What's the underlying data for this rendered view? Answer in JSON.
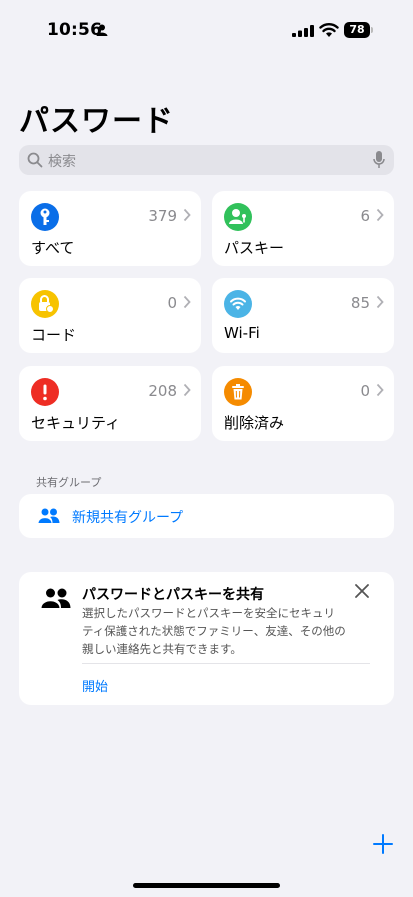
{
  "status_bar": {
    "time": "10:56",
    "battery": "78"
  },
  "page": {
    "title": "パスワード"
  },
  "search": {
    "placeholder": "検索"
  },
  "tiles": [
    {
      "label": "すべて",
      "count": "379",
      "color": "#0a6ee8",
      "icon": "key-icon"
    },
    {
      "label": "パスキー",
      "count": "6",
      "color": "#31c15b",
      "icon": "passkey-person-icon"
    },
    {
      "label": "コード",
      "count": "0",
      "color": "#f7c300",
      "icon": "lock-clock-icon"
    },
    {
      "label": "Wi-Fi",
      "count": "85",
      "color": "#4bb4e6",
      "icon": "wifi-icon"
    },
    {
      "label": "セキュリティ",
      "count": "208",
      "color": "#ee2d24",
      "icon": "exclamation-icon"
    },
    {
      "label": "削除済み",
      "count": "0",
      "color": "#f58b00",
      "icon": "trash-icon"
    }
  ],
  "shared_groups": {
    "header": "共有グループ",
    "new_group_label": "新規共有グループ"
  },
  "share_card": {
    "title": "パスワードとパスキーを共有",
    "body_lines": [
      "選択したパスワードとパスキーを安全にセキュリ",
      "ティ保護された状態でファミリー、友達、その他の",
      "親しい連絡先と共有できます。"
    ],
    "action": "開始"
  },
  "colors": {
    "accent": "#007aff",
    "background": "#f2f2f7"
  }
}
